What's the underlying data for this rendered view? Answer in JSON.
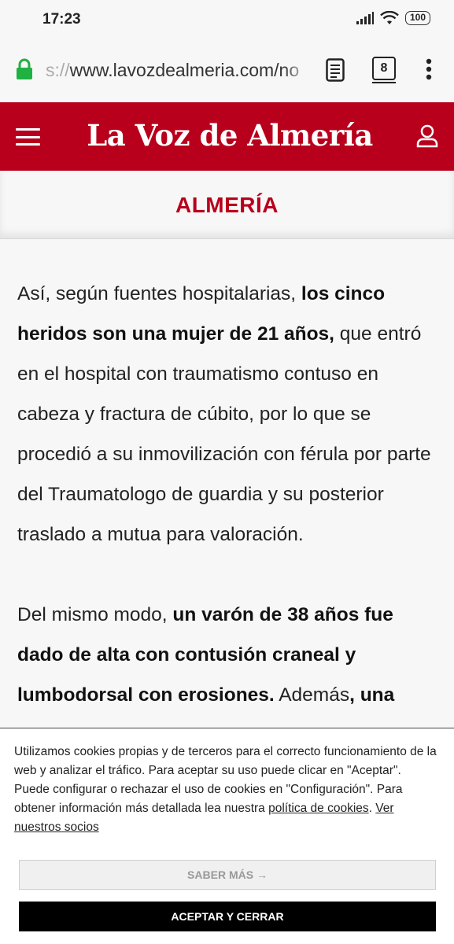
{
  "status_bar": {
    "time": "17:23",
    "battery": "100"
  },
  "browser": {
    "url_prefix": "s://",
    "url_main": "www.lavozdealmeria.com/no",
    "tab_count": "8"
  },
  "site": {
    "logo": "La Voz de Almería",
    "brand_color": "#b8001c"
  },
  "section": {
    "title": "ALMERÍA"
  },
  "article": {
    "p1_a": "Así, según fuentes hospitalarias, ",
    "p1_b": "los cinco heridos son una mujer de 21 años,",
    "p1_c": " que entró en el hospital con traumatismo contuso en cabeza y fractura de cúbito, por lo que se procedió a su inmovilización con férula por parte del Traumatologo de guardia y su posterior traslado a mutua para valoración.",
    "p2_a": "Del mismo modo, ",
    "p2_b": "un varón de 38 años fue dado de alta con contusión craneal y lumbodorsal con erosiones.",
    "p2_c": " Además",
    "p2_d": ", una"
  },
  "cookie": {
    "text": "Utilizamos cookies propias y de terceros para el correcto funcionamiento de la web y analizar el tráfico. Para aceptar su uso puede clicar en \"Aceptar\". Puede configurar o rechazar el uso de cookies en \"Configuración\". Para obtener información más detallada lea nuestra ",
    "policy_link": "política de cookies",
    "separator": ". ",
    "partners_link": "Ver nuestros socios",
    "more_button": "SABER MÁS →",
    "accept_button": "ACEPTAR Y CERRAR"
  }
}
